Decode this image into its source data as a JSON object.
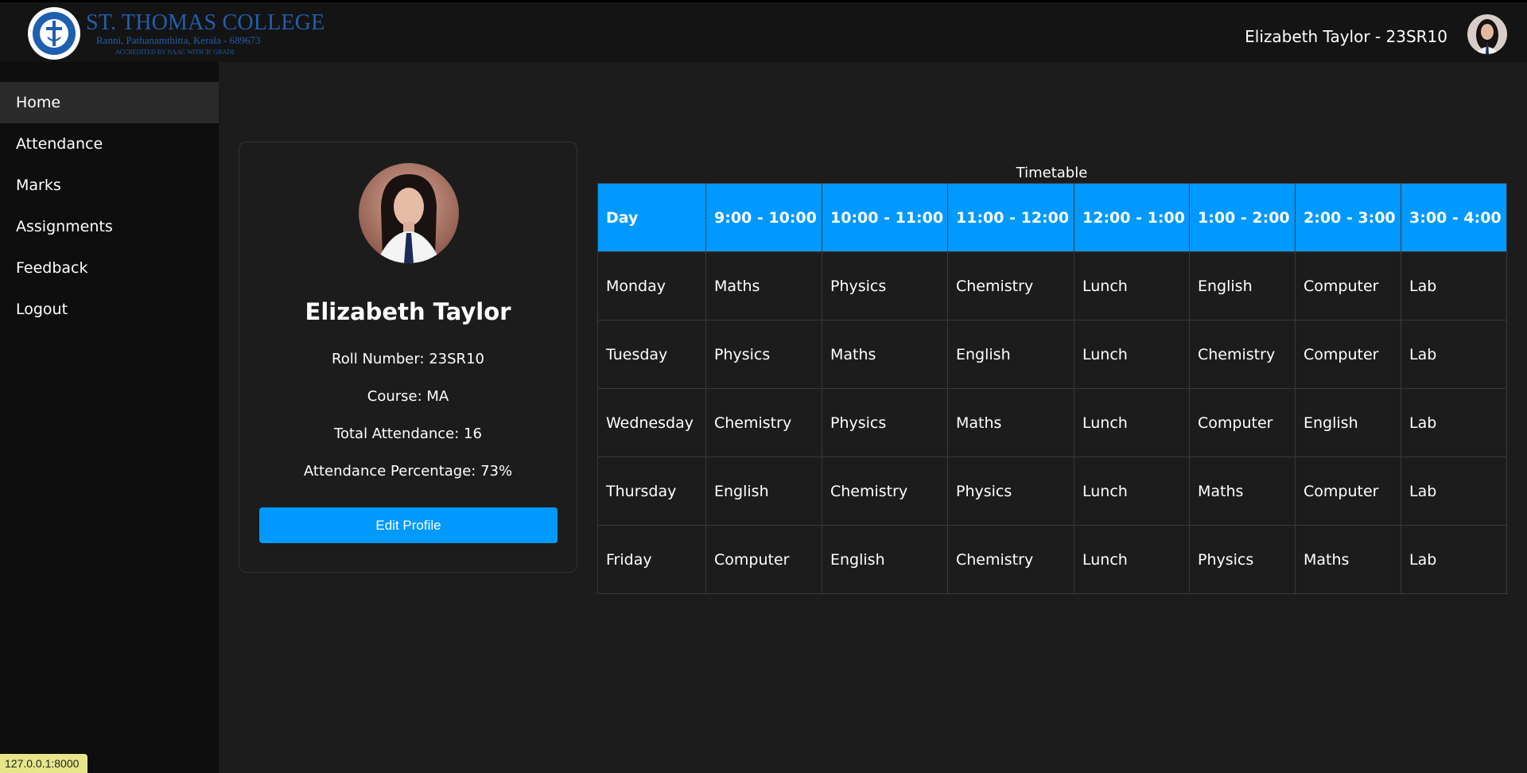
{
  "header": {
    "college_name": "ST. THOMAS COLLEGE",
    "college_address": "Ranni, Pathanamthitta, Kerala - 689673",
    "accreditation": "ACCREDITED BY NAAC WITH 'B' GRADE",
    "user_label": "Elizabeth Taylor - 23SR10"
  },
  "sidebar": {
    "items": [
      {
        "label": "Home",
        "active": true
      },
      {
        "label": "Attendance"
      },
      {
        "label": "Marks"
      },
      {
        "label": "Assignments"
      },
      {
        "label": "Feedback"
      },
      {
        "label": "Logout"
      }
    ]
  },
  "profile": {
    "name": "Elizabeth Taylor",
    "roll": "Roll Number: 23SR10",
    "course": "Course: MA",
    "total_attendance": "Total Attendance: 16",
    "attendance_pct": "Attendance Percentage: 73%",
    "edit_label": "Edit Profile"
  },
  "timetable": {
    "caption": "Timetable",
    "headers": [
      "Day",
      "9:00 - 10:00",
      "10:00 - 11:00",
      "11:00 - 12:00",
      "12:00 - 1:00",
      "1:00 - 2:00",
      "2:00 - 3:00",
      "3:00 - 4:00"
    ],
    "rows": [
      [
        "Monday",
        "Maths",
        "Physics",
        "Chemistry",
        "Lunch",
        "English",
        "Computer",
        "Lab"
      ],
      [
        "Tuesday",
        "Physics",
        "Maths",
        "English",
        "Lunch",
        "Chemistry",
        "Computer",
        "Lab"
      ],
      [
        "Wednesday",
        "Chemistry",
        "Physics",
        "Maths",
        "Lunch",
        "Computer",
        "English",
        "Lab"
      ],
      [
        "Thursday",
        "English",
        "Chemistry",
        "Physics",
        "Lunch",
        "Maths",
        "Computer",
        "Lab"
      ],
      [
        "Friday",
        "Computer",
        "English",
        "Chemistry",
        "Lunch",
        "Physics",
        "Maths",
        "Lab"
      ]
    ]
  },
  "status_bar": {
    "url": "127.0.0.1:8000"
  },
  "colors": {
    "accent": "#0099ff",
    "brand": "#1f5fb0"
  }
}
